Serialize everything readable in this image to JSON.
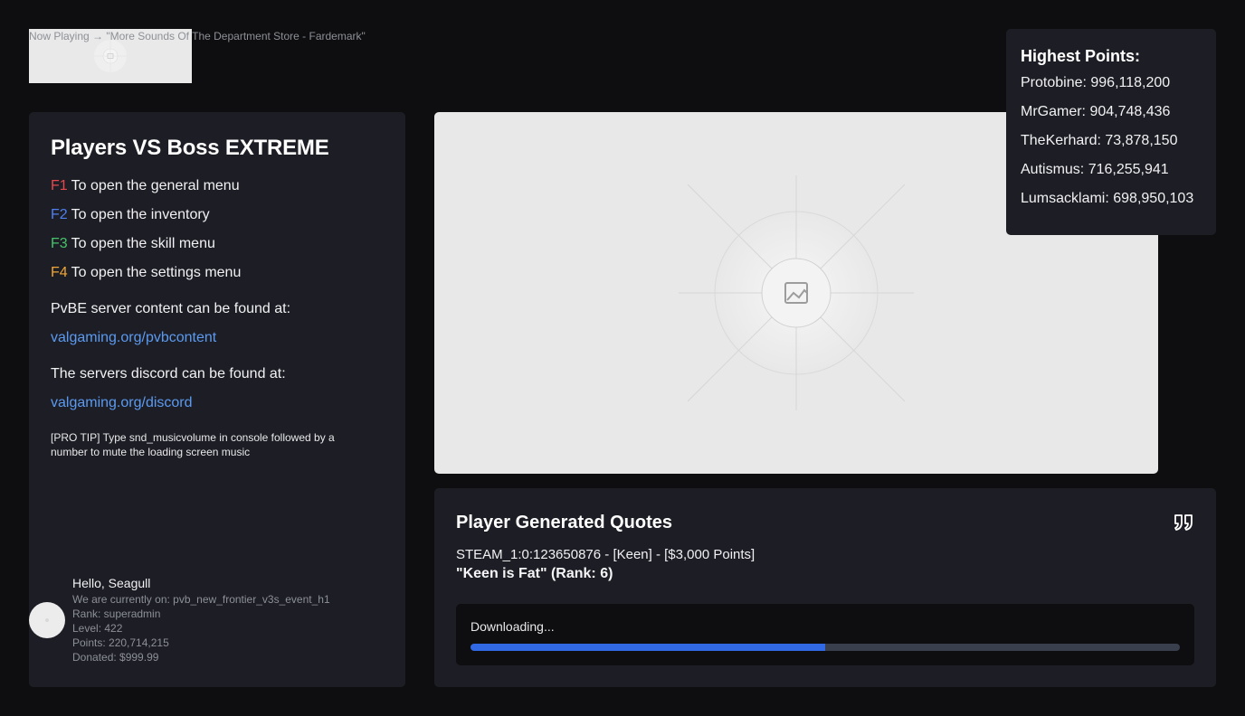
{
  "now_playing": {
    "text": "Now Playing → \"More Sounds Of The Department Store - Fardemark\""
  },
  "left_panel": {
    "title": "Players VS Boss EXTREME",
    "keys": [
      {
        "key": "F1",
        "desc": "To open the general menu",
        "color": "#e5484d"
      },
      {
        "key": "F2",
        "desc": "To open the inventory",
        "color": "#4f7ff0"
      },
      {
        "key": "F3",
        "desc": "To open the skill menu",
        "color": "#46c36a"
      },
      {
        "key": "F4",
        "desc": "To open the settings menu",
        "color": "#f0a535"
      }
    ],
    "content_label": "PvBE server content can be found at:",
    "content_link": "valgaming.org/pvbcontent",
    "discord_label": "The servers discord can be found at:",
    "discord_link": "valgaming.org/discord",
    "pro_tip": "[PRO TIP] Type snd_musicvolume in console followed by a number to mute the loading screen music"
  },
  "user": {
    "hello": "Hello, Seagull",
    "map": "We are currently on: pvb_new_frontier_v3s_event_h1",
    "rank": "Rank: superadmin",
    "level": "Level: 422",
    "points": "Points: 220,714,215",
    "donated": "Donated: $999.99"
  },
  "quotes": {
    "title": "Player Generated Quotes",
    "icon": "quote-icon",
    "source": "STEAM_1:0:123650876 - [Keen] - [$3,000 Points]",
    "quote": "\"Keen is Fat\" (Rank: 6)"
  },
  "download": {
    "status": "Downloading...",
    "progress": 0.5
  },
  "scores": {
    "title": "Highest Points:",
    "entries": [
      "Protobine: 996,118,200",
      "MrGamer: 904,748,436",
      "TheKerhard: 73,878,150",
      "Autismus: 716,255,941",
      "Lumsacklami: 698,950,103"
    ]
  },
  "colors": {
    "accent": "#3069e3",
    "link": "#5b9af0",
    "panel": "#1d1e25",
    "background": "#0e0e10"
  }
}
